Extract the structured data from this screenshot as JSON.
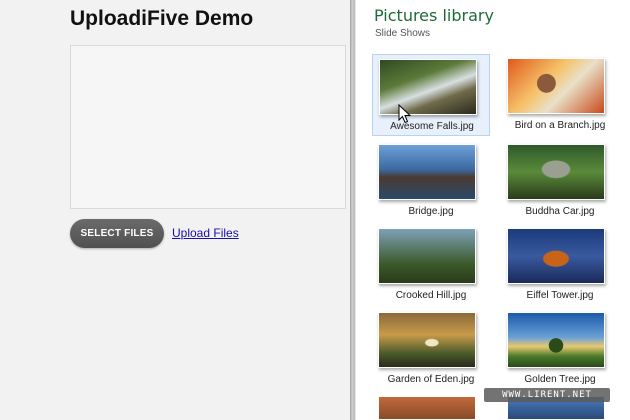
{
  "demo": {
    "title": "UploadiFive Demo",
    "select_label": "SELECT FILES",
    "upload_label": "Upload Files"
  },
  "library": {
    "title": "Pictures library",
    "subtitle": "Slide Shows",
    "files": [
      {
        "name": "Awesome Falls.jpg",
        "selected": true
      },
      {
        "name": "Bird on a Branch.jpg"
      },
      {
        "name": "Bridge.jpg"
      },
      {
        "name": "Buddha Car.jpg"
      },
      {
        "name": "Crooked Hill.jpg"
      },
      {
        "name": "Eiffel Tower.jpg"
      },
      {
        "name": "Garden of Eden.jpg"
      },
      {
        "name": "Golden Tree.jpg"
      }
    ]
  },
  "watermark": "WWW.LIRENT.NET",
  "icons": {
    "cursor": "mouse-pointer-icon"
  }
}
